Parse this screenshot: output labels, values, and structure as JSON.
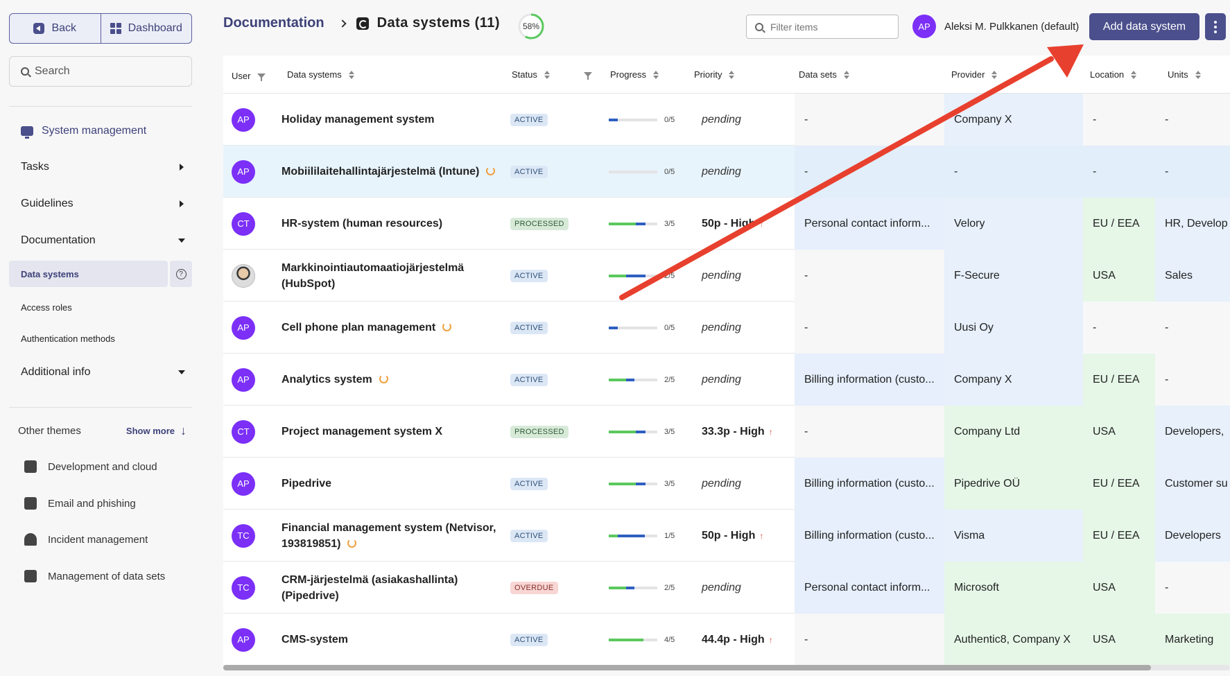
{
  "sidebar": {
    "back_label": "Back",
    "dashboard_label": "Dashboard",
    "search_label": "Search",
    "system_management": "System management",
    "tasks": "Tasks",
    "guidelines": "Guidelines",
    "documentation": "Documentation",
    "data_systems": "Data systems",
    "access_roles": "Access roles",
    "auth_methods": "Authentication methods",
    "additional_info": "Additional info",
    "other_themes": "Other themes",
    "show_more": "Show more",
    "themes": [
      "Development and cloud",
      "Email and phishing",
      "Incident management",
      "Management of data sets"
    ]
  },
  "header": {
    "breadcrumb_root": "Documentation",
    "title": "Data systems (11)",
    "progress_label": "58%",
    "progress_value": 0.58,
    "filter_placeholder": "Filter items",
    "user_initials": "AP",
    "user_name": "Aleksi M. Pulkkanen (default)",
    "add_button": "Add data system"
  },
  "table": {
    "columns": [
      "User",
      "Data systems",
      "Status",
      "Progress",
      "Priority",
      "Data sets",
      "Provider",
      "Location",
      "Units"
    ],
    "rows": [
      {
        "user": "AP",
        "photo": false,
        "name": "Holiday management system",
        "spinner": false,
        "status": "ACTIVE",
        "progress": "0/5",
        "green": 0,
        "blue": 0.18,
        "priority": "pending",
        "high": false,
        "datasets": "-",
        "provider": "Company X",
        "location": "-",
        "units": "-",
        "c_ds": "gray",
        "c_pr": "lb",
        "c_lo": "gray",
        "c_un": "gray"
      },
      {
        "user": "AP",
        "photo": false,
        "name": "Mobiililaitehallintajärjestelmä (Intune)",
        "spinner": true,
        "status": "ACTIVE",
        "progress": "0/5",
        "green": 0,
        "blue": 0,
        "priority": "pending",
        "high": false,
        "datasets": "-",
        "provider": "-",
        "location": "-",
        "units": "-",
        "c_ds": "gray",
        "c_pr": "gray",
        "c_lo": "gray",
        "c_un": "gray"
      },
      {
        "user": "CT",
        "photo": false,
        "name": "HR-system (human resources)",
        "spinner": false,
        "status": "PROCESSED",
        "progress": "3/5",
        "green": 0.55,
        "blue": 0.2,
        "priority": "50p - High",
        "high": true,
        "datasets": "Personal contact inform...",
        "provider": "Velory",
        "location": "EU / EEA",
        "units": "HR, Develop",
        "c_ds": "blue",
        "c_pr": "lb",
        "c_lo": "green",
        "c_un": "lb"
      },
      {
        "user": "",
        "photo": true,
        "name": "Markkinointiautomaatiojärjestelmä (HubSpot)",
        "spinner": false,
        "status": "ACTIVE",
        "progress": "2/5",
        "green": 0.35,
        "blue": 0.4,
        "priority": "pending",
        "high": false,
        "datasets": "-",
        "provider": "F-Secure",
        "location": "USA",
        "units": "Sales",
        "c_ds": "gray",
        "c_pr": "lb",
        "c_lo": "green",
        "c_un": "lb"
      },
      {
        "user": "AP",
        "photo": false,
        "name": "Cell phone plan management",
        "spinner": true,
        "status": "ACTIVE",
        "progress": "0/5",
        "green": 0,
        "blue": 0.18,
        "priority": "pending",
        "high": false,
        "datasets": "-",
        "provider": "Uusi Oy",
        "location": "-",
        "units": "-",
        "c_ds": "gray",
        "c_pr": "lb",
        "c_lo": "gray",
        "c_un": "gray"
      },
      {
        "user": "AP",
        "photo": false,
        "name": "Analytics system",
        "spinner": true,
        "status": "ACTIVE",
        "progress": "2/5",
        "green": 0.35,
        "blue": 0.18,
        "priority": "pending",
        "high": false,
        "datasets": "Billing information (custo...",
        "provider": "Company X",
        "location": "EU / EEA",
        "units": "-",
        "c_ds": "blue",
        "c_pr": "lb",
        "c_lo": "green",
        "c_un": "gray"
      },
      {
        "user": "CT",
        "photo": false,
        "name": "Project management system X",
        "spinner": false,
        "status": "PROCESSED",
        "progress": "3/5",
        "green": 0.55,
        "blue": 0.2,
        "priority": "33.3p - High",
        "high": true,
        "datasets": "-",
        "provider": "Company Ltd",
        "location": "USA",
        "units": "Developers,",
        "c_ds": "gray",
        "c_pr": "green",
        "c_lo": "green",
        "c_un": "lb"
      },
      {
        "user": "AP",
        "photo": false,
        "name": "Pipedrive",
        "spinner": false,
        "status": "ACTIVE",
        "progress": "3/5",
        "green": 0.55,
        "blue": 0.2,
        "priority": "pending",
        "high": false,
        "datasets": "Billing information (custo...",
        "provider": "Pipedrive OÜ",
        "location": "EU / EEA",
        "units": "Customer su",
        "c_ds": "blue",
        "c_pr": "green",
        "c_lo": "green",
        "c_un": "lb"
      },
      {
        "user": "TC",
        "photo": false,
        "name": "Financial management system (Netvisor, 193819851)",
        "spinner": true,
        "status": "ACTIVE",
        "progress": "1/5",
        "green": 0.18,
        "blue": 0.57,
        "priority": "50p - High",
        "high": true,
        "datasets": "Billing information (custo...",
        "provider": "Visma",
        "location": "EU / EEA",
        "units": "Developers",
        "c_ds": "blue",
        "c_pr": "lb",
        "c_lo": "green",
        "c_un": "lb"
      },
      {
        "user": "TC",
        "photo": false,
        "name": "CRM-järjestelmä (asiakashallinta) (Pipedrive)",
        "spinner": false,
        "status": "OVERDUE",
        "progress": "2/5",
        "green": 0.35,
        "blue": 0.18,
        "priority": "pending",
        "high": false,
        "datasets": "Personal contact inform...",
        "provider": "Microsoft",
        "location": "USA",
        "units": "-",
        "c_ds": "blue",
        "c_pr": "green",
        "c_lo": "green",
        "c_un": "gray"
      },
      {
        "user": "AP",
        "photo": false,
        "name": "CMS-system",
        "spinner": false,
        "status": "ACTIVE",
        "progress": "4/5",
        "green": 0.72,
        "blue": 0,
        "priority": "44.4p - High",
        "high": true,
        "datasets": "-",
        "provider": "Authentic8, Company X",
        "location": "USA",
        "units": "Marketing",
        "c_ds": "gray",
        "c_pr": "green",
        "c_lo": "green",
        "c_un": "green"
      }
    ]
  },
  "colors": {
    "accent": "#4b4f8c",
    "annotation_arrow": "#e8402e"
  }
}
